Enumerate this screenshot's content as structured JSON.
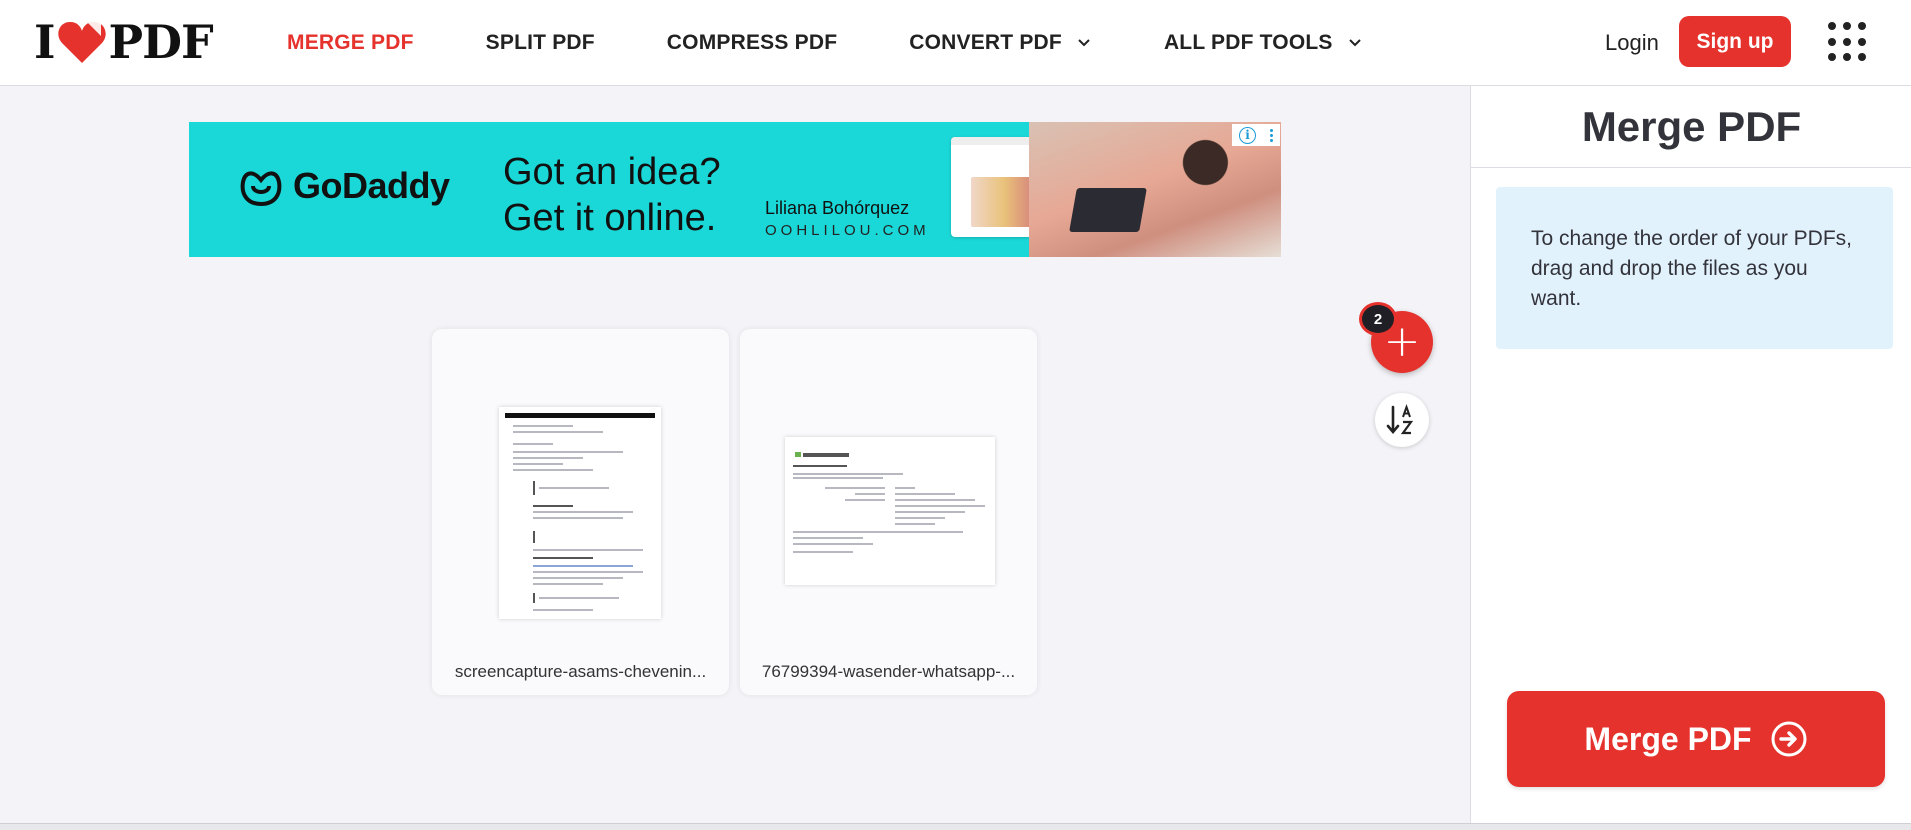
{
  "header": {
    "logo_left": "I",
    "logo_right": "PDF",
    "nav": [
      {
        "label": "MERGE PDF",
        "active": true
      },
      {
        "label": "SPLIT PDF"
      },
      {
        "label": "COMPRESS PDF"
      },
      {
        "label": "CONVERT PDF",
        "dropdown": true
      },
      {
        "label": "ALL PDF TOOLS",
        "dropdown": true
      }
    ],
    "login_label": "Login",
    "signup_label": "Sign up"
  },
  "ad": {
    "brand": "GoDaddy",
    "headline_1": "Got an idea?",
    "headline_2": "Get it online.",
    "person": "Liliana Bohórquez",
    "site": "OOHLILOU.COM"
  },
  "files": [
    {
      "name": "screencapture-asams-chevenin..."
    },
    {
      "name": "76799394-wasender-whatsapp-..."
    }
  ],
  "file_count": "2",
  "sidebar": {
    "title": "Merge PDF",
    "info": "To change the order of your PDFs, drag and drop the files as you want.",
    "merge_button": "Merge PDF"
  },
  "colors": {
    "brand_red": "#e5322d",
    "ad_teal": "#1bd8d8",
    "info_blue": "#e2f2fd"
  }
}
